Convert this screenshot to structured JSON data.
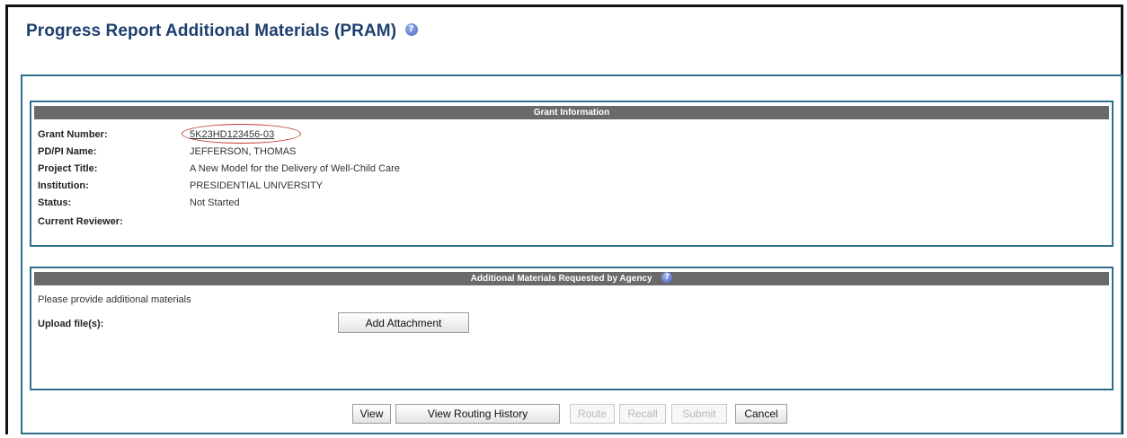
{
  "page": {
    "title": "Progress Report Additional Materials (PRAM)",
    "help_glyph": "?"
  },
  "grant_info": {
    "header": "Grant Information",
    "rows": [
      {
        "label": "Grant Number:",
        "value": "5K23HD123456-03"
      },
      {
        "label": "PD/PI Name:",
        "value": "JEFFERSON, THOMAS"
      },
      {
        "label": "Project Title:",
        "value": "A New Model for the Delivery of Well-Child Care"
      },
      {
        "label": "Institution:",
        "value": "PRESIDENTIAL UNIVERSITY"
      },
      {
        "label": "Status:",
        "value": "Not Started"
      },
      {
        "label": "Current Reviewer:",
        "value": ""
      }
    ]
  },
  "materials": {
    "header": "Additional Materials Requested by Agency",
    "instruction": "Please provide additional materials",
    "upload_label": "Upload file(s):",
    "add_attachment_label": "Add Attachment"
  },
  "actions": {
    "view": "View",
    "view_routing_history": "View Routing History",
    "route": "Route",
    "recall": "Recall",
    "submit": "Submit",
    "cancel": "Cancel"
  },
  "colors": {
    "title": "#1d3f6e",
    "panel_border": "#2f6f8c",
    "header_bar": "#6a6a6a",
    "link": "#2a5fb0",
    "highlight_oval": "#c0392b"
  },
  "icons": {
    "help": "help-circle-icon"
  }
}
